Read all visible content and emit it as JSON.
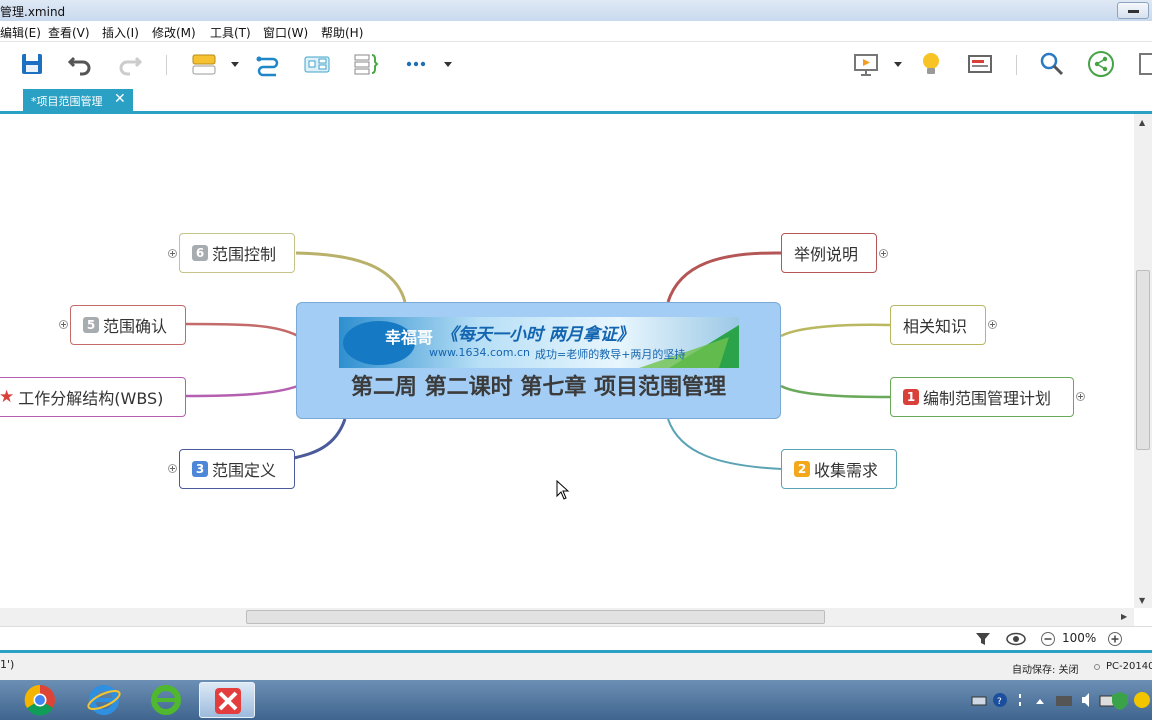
{
  "window": {
    "title": "管理.xmind"
  },
  "menu": [
    "编辑(E)",
    "查看(V)",
    "插入(I)",
    "修改(M)",
    "工具(T)",
    "窗口(W)",
    "帮助(H)"
  ],
  "toolbar": {
    "icons": [
      "save-icon",
      "undo-icon",
      "redo-icon",
      "topic-icon",
      "relationship-icon",
      "summary-icon",
      "boundary-icon",
      "more-icon",
      "presentation-icon",
      "idea-icon",
      "outline-icon",
      "search-icon",
      "share-icon"
    ]
  },
  "tab": {
    "label": "*项目范围管理",
    "close": "✕"
  },
  "central": {
    "banner_logo": "幸福哥",
    "banner_slogan": "《每天一小时  两月拿证》",
    "banner_url": "www.1634.com.cn",
    "banner_motto": "成功=老师的教导+两月的坚持",
    "title": "第二周 第二课时  第七章 项目范围管理"
  },
  "topics": {
    "scope_control": {
      "num": "6",
      "label": "范围控制",
      "color": "#a7acb0",
      "border": "#c5c28a"
    },
    "scope_verify": {
      "num": "5",
      "label": "范围确认",
      "color": "#a7acb0",
      "border": "#c46a6a"
    },
    "wbs": {
      "label": "工作分解结构(WBS)",
      "border": "#b45fb0",
      "star": "★"
    },
    "scope_define": {
      "num": "3",
      "label": "范围定义",
      "color": "#4d88d8",
      "border": "#4a5a9a"
    },
    "example": {
      "label": "举例说明",
      "border": "#b45656"
    },
    "knowledge": {
      "label": "相关知识",
      "border": "#b9b860"
    },
    "plan": {
      "num": "1",
      "label": "编制范围管理计划",
      "color": "#d9403a",
      "border": "#6aa85a"
    },
    "requirements": {
      "num": "2",
      "label": "收集需求",
      "color": "#f3a81b",
      "border": "#5aa3b4"
    }
  },
  "viewbar": {
    "zoom": "100%"
  },
  "status": {
    "left": "1')",
    "autosave": "自动保存: 关闭",
    "pc": "PC-20140"
  },
  "taskbar": {
    "apps": [
      "chrome-icon",
      "ie-icon",
      "ie-green-icon",
      "xmind-icon"
    ]
  }
}
